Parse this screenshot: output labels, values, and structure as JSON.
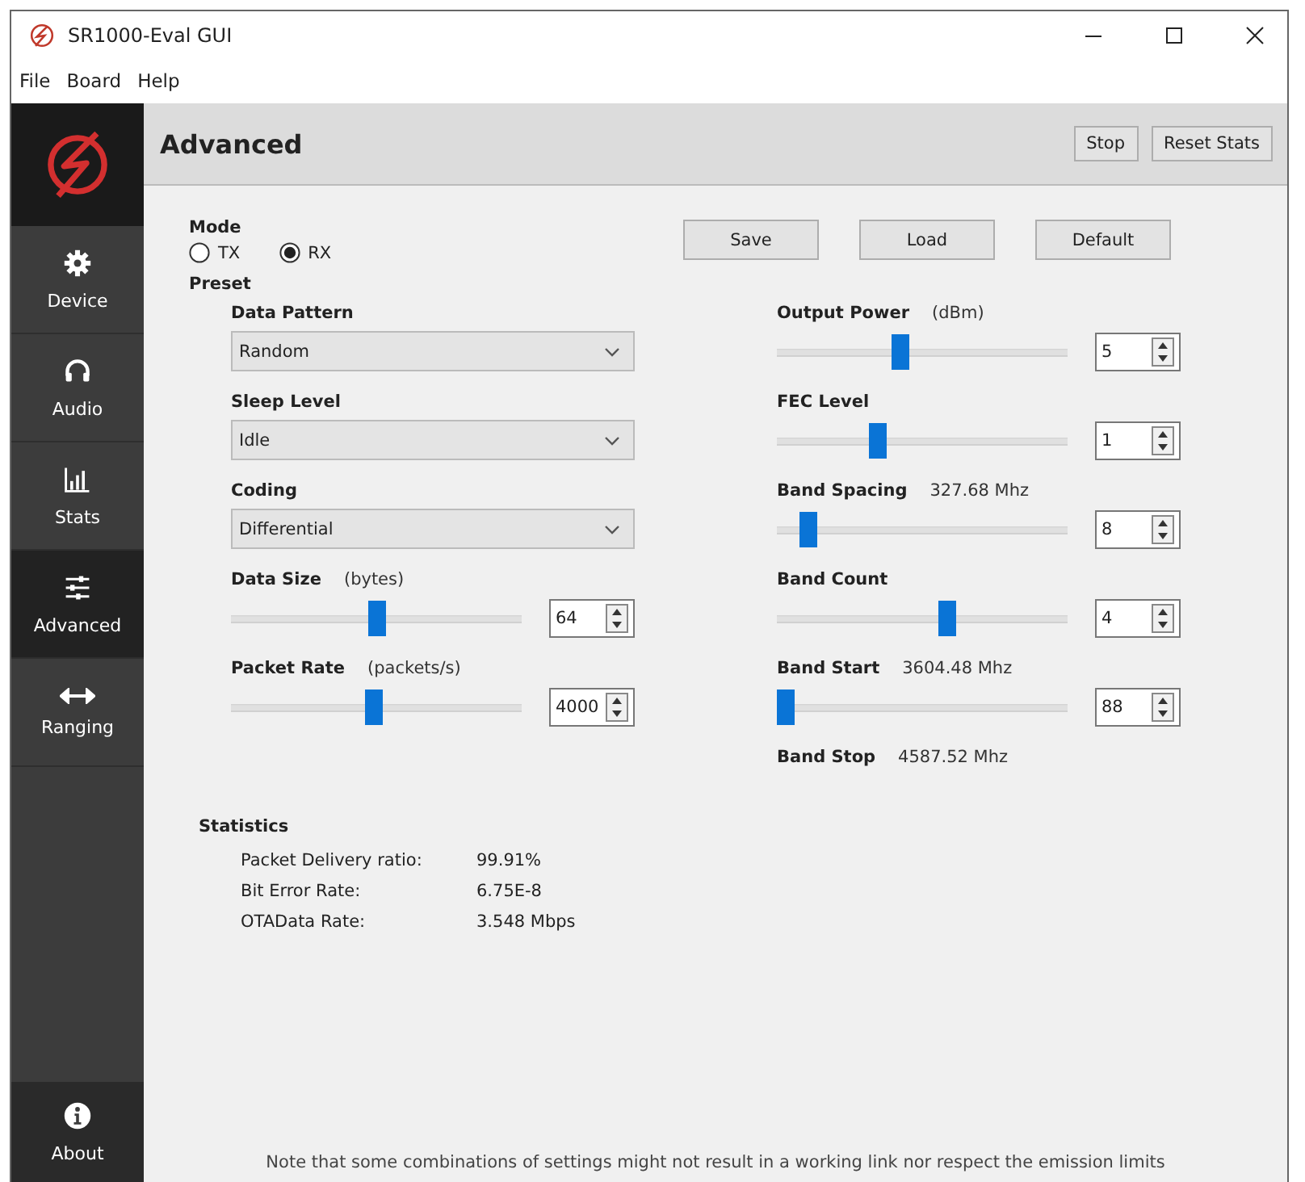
{
  "window": {
    "title": "SR1000-Eval GUI"
  },
  "menu": [
    "File",
    "Board",
    "Help"
  ],
  "sidebar": {
    "items": [
      {
        "label": "Device",
        "selected": false
      },
      {
        "label": "Audio",
        "selected": false
      },
      {
        "label": "Stats",
        "selected": false
      },
      {
        "label": "Advanced",
        "selected": true
      },
      {
        "label": "Ranging",
        "selected": false
      }
    ],
    "footer": {
      "label": "About"
    }
  },
  "header": {
    "title": "Advanced",
    "buttons": [
      "Stop",
      "Reset Stats"
    ]
  },
  "mode": {
    "label": "Mode",
    "options": [
      {
        "label": "TX",
        "selected": false
      },
      {
        "label": "RX",
        "selected": true
      }
    ]
  },
  "preset": {
    "label": "Preset",
    "buttons": [
      "Save",
      "Load",
      "Default"
    ]
  },
  "left_settings": [
    {
      "kind": "dropdown",
      "label": "Data Pattern",
      "value": "Random"
    },
    {
      "kind": "dropdown",
      "label": "Sleep Level",
      "value": "Idle"
    },
    {
      "kind": "dropdown",
      "label": "Coding",
      "value": "Differential"
    },
    {
      "kind": "slider",
      "label": "Data Size",
      "unit": "(bytes)",
      "level": 0.5,
      "value": "64"
    },
    {
      "kind": "slider",
      "label": "Packet Rate",
      "unit": "(packets/s)",
      "level": 0.49,
      "value": "4000"
    }
  ],
  "right_settings": [
    {
      "kind": "slider",
      "label": "Output Power",
      "unit": "(dBm)",
      "level": 0.42,
      "value": "5"
    },
    {
      "kind": "slider",
      "label": "FEC Level",
      "level": 0.34,
      "value": "1"
    },
    {
      "kind": "slider",
      "label": "Band Spacing",
      "reading": "327.68 Mhz",
      "level": 0.08,
      "value": "8"
    },
    {
      "kind": "slider",
      "label": "Band Count",
      "level": 0.59,
      "value": "4"
    },
    {
      "kind": "slider",
      "label": "Band Start",
      "reading": "3604.48 Mhz",
      "level": 0.0,
      "value": "88"
    },
    {
      "kind": "readout",
      "label": "Band Stop",
      "reading": "4587.52 Mhz"
    }
  ],
  "statistics": {
    "title": "Statistics",
    "rows": [
      {
        "label": "Packet Delivery ratio:",
        "value": "99.91%"
      },
      {
        "label": "Bit Error Rate:",
        "value": "6.75E-8"
      },
      {
        "label": "OTAData Rate:",
        "value": "3.548 Mbps"
      }
    ]
  },
  "note": "Note that some combinations of settings might not result in a working link nor respect the emission limits"
}
